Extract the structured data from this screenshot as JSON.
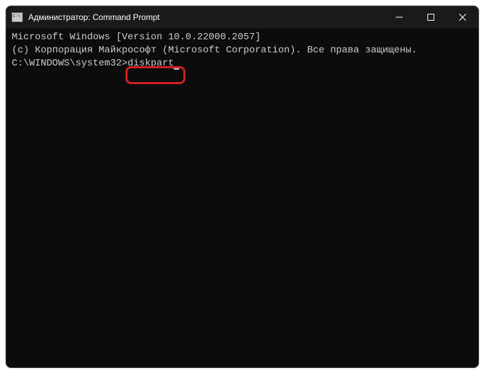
{
  "titlebar": {
    "title": "Администратор: Command Prompt"
  },
  "terminal": {
    "line1": "Microsoft Windows [Version 10.0.22000.2057]",
    "line2": "(c) Корпорация Майкрософт (Microsoft Corporation). Все права защищены.",
    "blank": "",
    "prompt": "C:\\WINDOWS\\system32>",
    "command": "diskpart"
  }
}
